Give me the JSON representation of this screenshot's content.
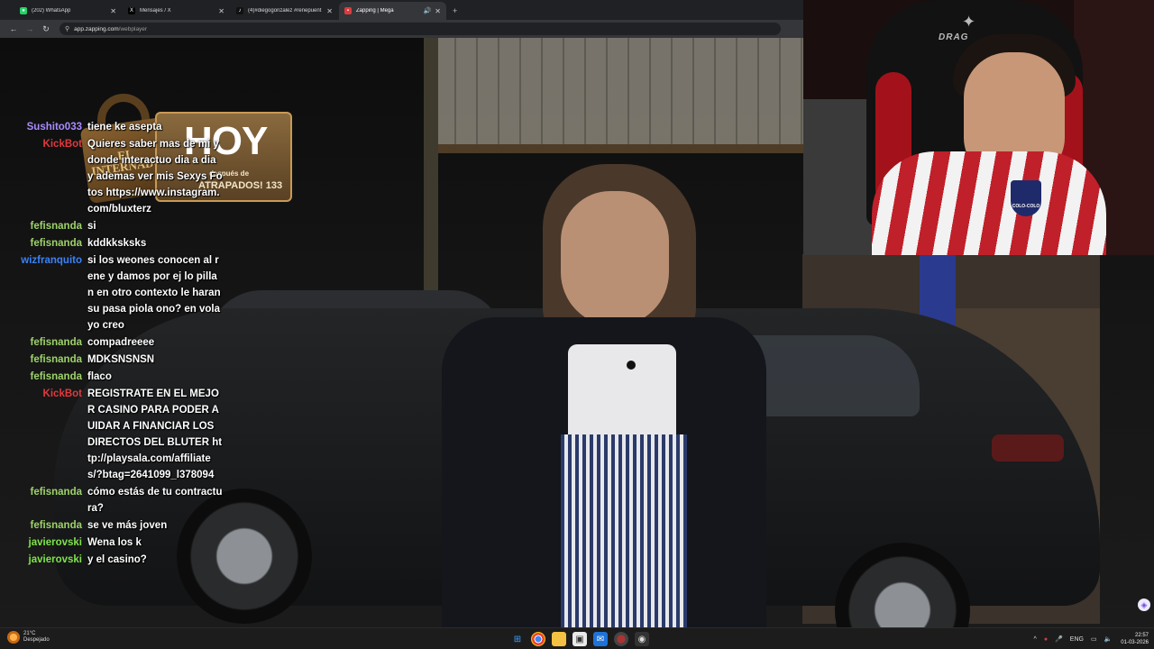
{
  "browser": {
    "tabs": [
      {
        "label": "(202) WhatsApp",
        "icon": "whatsapp-icon",
        "color": "#25d366",
        "active": false
      },
      {
        "label": "Mensajes / X",
        "icon": "x-logo-icon",
        "color": "#000000",
        "active": false
      },
      {
        "label": "(4)#diegogonzalez #renepuent",
        "icon": "tiktok-icon",
        "color": "#111111",
        "active": false
      },
      {
        "label": "Zapping | Mega",
        "icon": "zapping-icon",
        "color": "#e03a3e",
        "active": true
      }
    ],
    "new_tab": "+",
    "url_host": "app.zapping.com",
    "url_path": "/webplayer"
  },
  "logo": {
    "lock_text": "EL INTERNADO",
    "big_text": "HOY",
    "sub_text": "después de",
    "sub_text2": "ATRAPADOS! 133"
  },
  "chat": [
    {
      "user": "Sushito033",
      "color": "#a98bff",
      "text": "tiene ke asepta"
    },
    {
      "user": "KickBot",
      "color": "#e0393e",
      "text": "Quieres saber mas de mi y donde interactuo dia a dia y ademas ver mis Sexys Fotos https://www.instagram.com/bluxterz"
    },
    {
      "user": "fefisnanda",
      "color": "#9ed36a",
      "text": "si"
    },
    {
      "user": "fefisnanda",
      "color": "#9ed36a",
      "text": "kddkksksks"
    },
    {
      "user": "wizfranquito",
      "color": "#3b82f6",
      "text": "si los weones conocen al rene y damos por ej lo pillan en otro contexto le haran su pasa piola ono? en vola yo creo"
    },
    {
      "user": "fefisnanda",
      "color": "#9ed36a",
      "text": "compadreeee"
    },
    {
      "user": "fefisnanda",
      "color": "#9ed36a",
      "text": "MDKSNSNSN"
    },
    {
      "user": "fefisnanda",
      "color": "#9ed36a",
      "text": "flaco"
    },
    {
      "user": "KickBot",
      "color": "#e0393e",
      "text": "REGISTRATE EN EL MEJOR CASINO PARA PODER AUIDAR A FINANCIAR LOS DIRECTOS DEL BLUTER http://playsala.com/affiliates/?btag=2641099_l378094"
    },
    {
      "user": "fefisnanda",
      "color": "#9ed36a",
      "text": "cómo estás de tu contractura?"
    },
    {
      "user": "fefisnanda",
      "color": "#9ed36a",
      "text": "se ve más joven"
    },
    {
      "user": "javierovski",
      "color": "#7fe34a",
      "text": "Wena los k"
    },
    {
      "user": "javierovski",
      "color": "#7fe34a",
      "text": "y el casino?"
    }
  ],
  "webcam": {
    "chair_logo": "DRAG",
    "crest_text": "COLO-COLO"
  },
  "taskbar": {
    "weather_temp": "21°C",
    "weather_desc": "Despejado",
    "lang": "ENG",
    "time": "22:57",
    "date": "01-03-2026",
    "apps": [
      "windows-start-icon",
      "chrome-icon",
      "file-explorer-icon",
      "store-icon",
      "mail-icon",
      "chrome-profile-icon",
      "obs-icon"
    ]
  }
}
